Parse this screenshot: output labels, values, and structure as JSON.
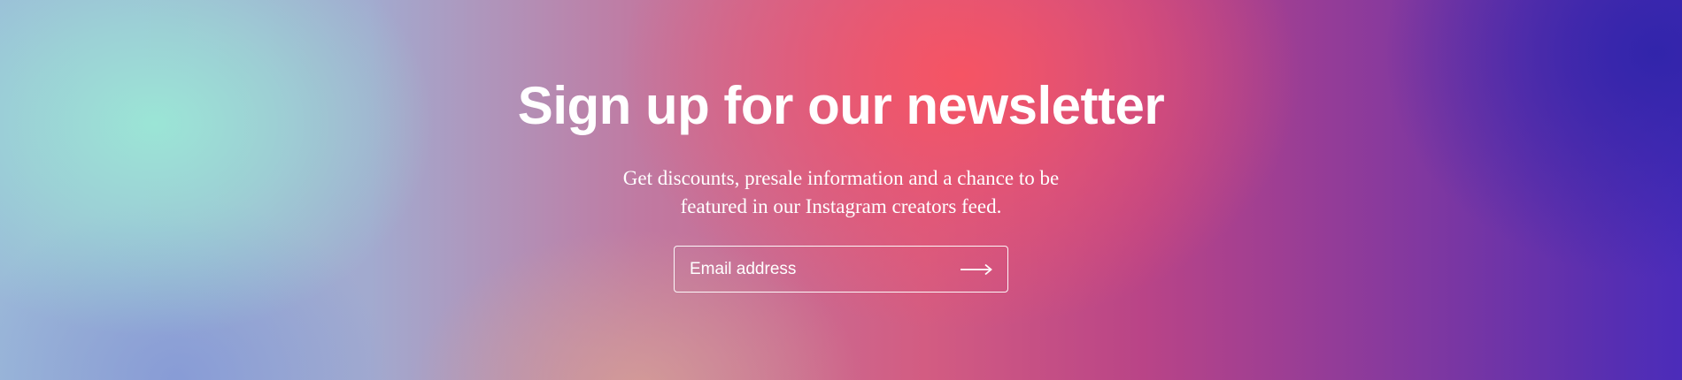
{
  "newsletter": {
    "title": "Sign up for our newsletter",
    "subtitle": "Get discounts, presale information and a chance to be featured in our Instagram creators feed.",
    "email_placeholder": "Email address",
    "submit_icon": "arrow-right-icon"
  },
  "colors": {
    "text": "#ffffff",
    "gradient_teal": "#9be8d6",
    "gradient_coral": "#f85462",
    "gradient_indigo": "#3024aa"
  }
}
